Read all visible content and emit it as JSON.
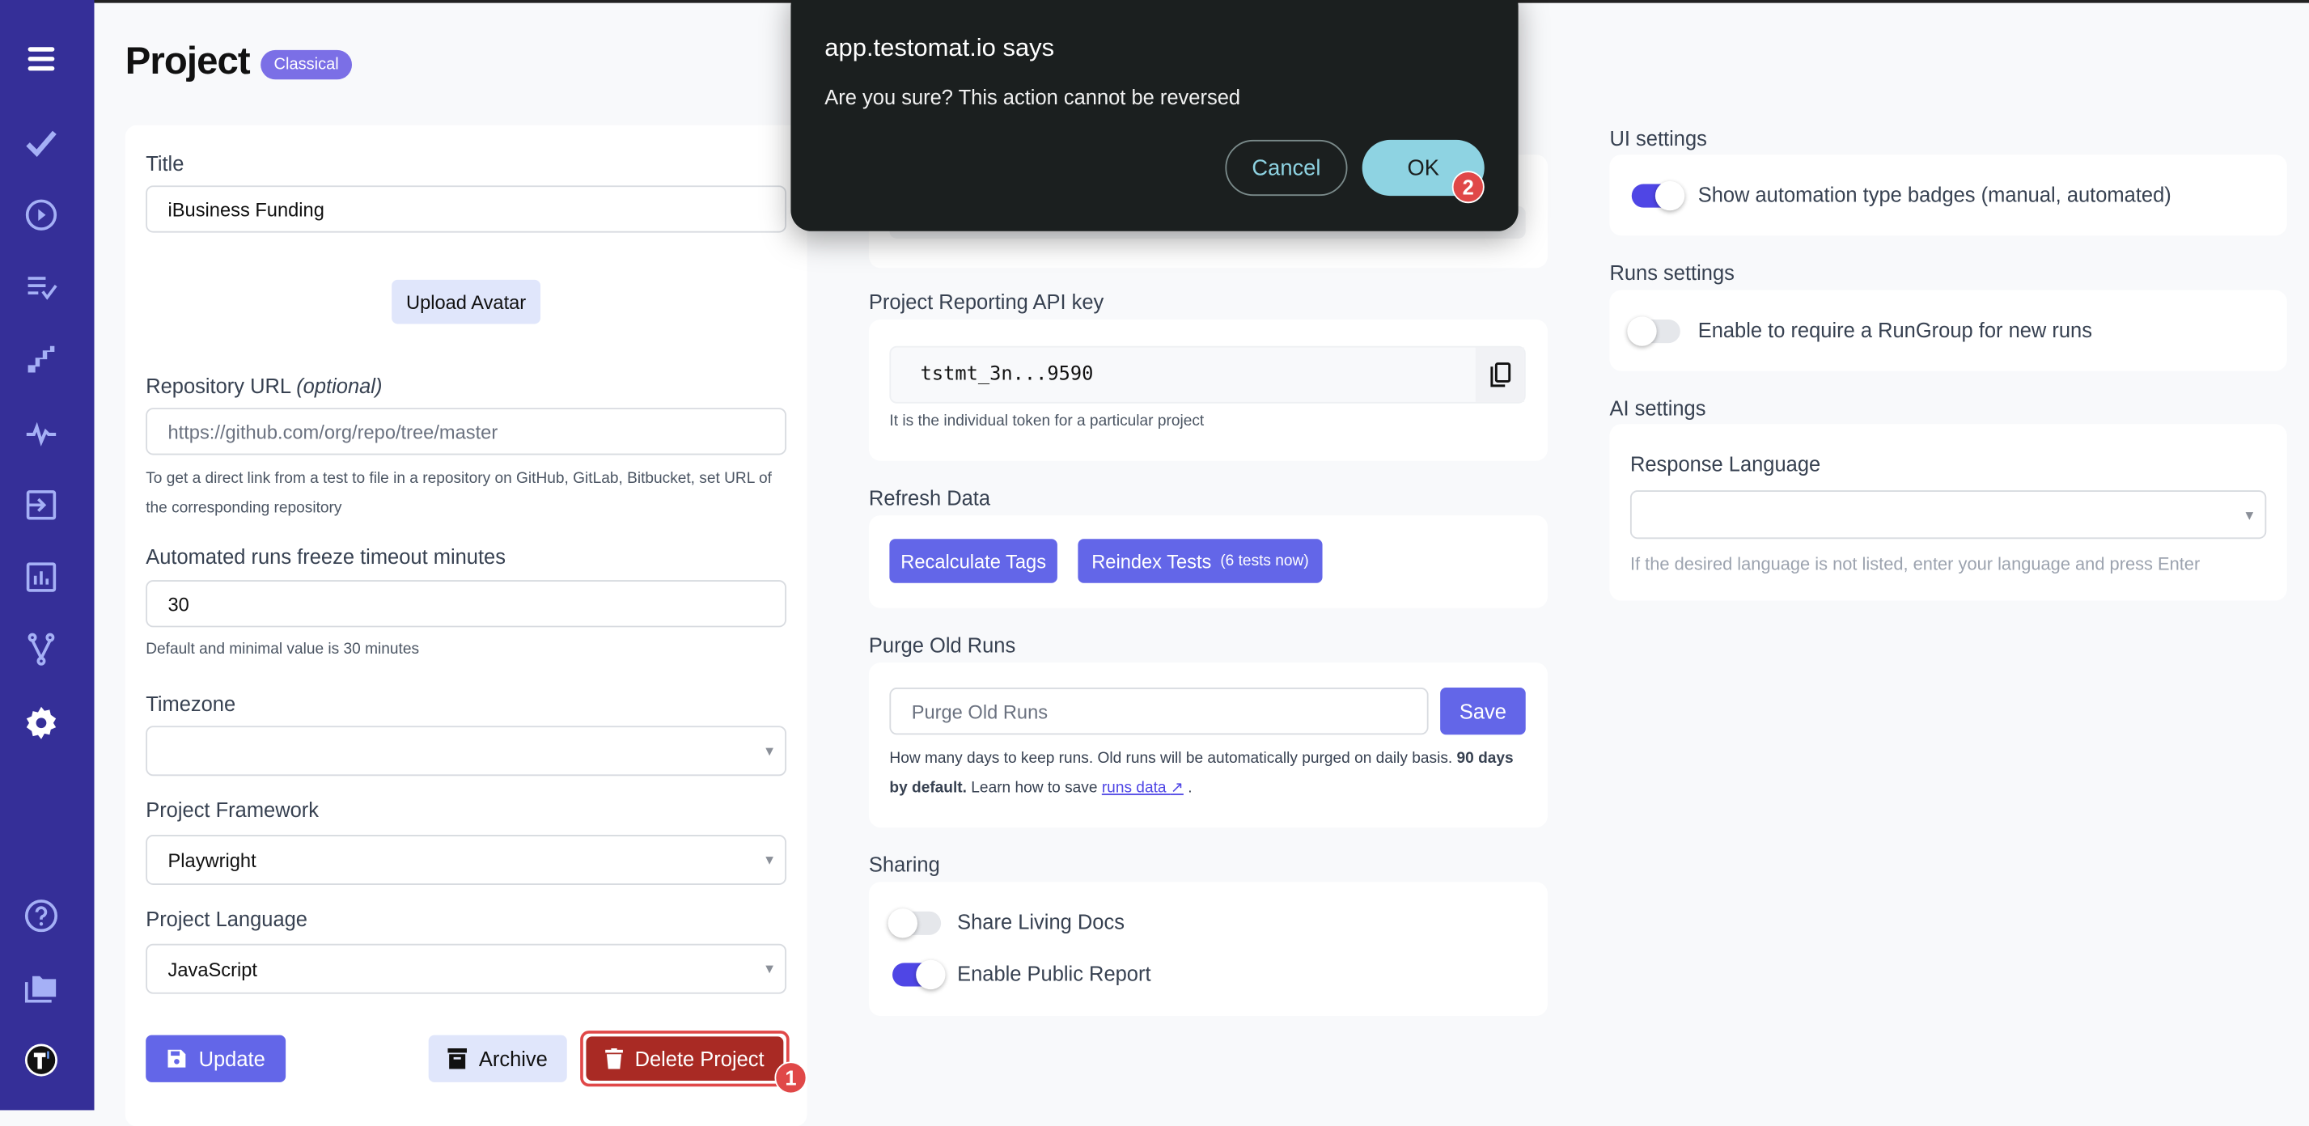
{
  "dialog": {
    "title": "app.testomat.io says",
    "message": "Are you sure? This action cannot be reversed",
    "cancel_label": "Cancel",
    "ok_label": "OK",
    "ok_marker": "2"
  },
  "sidebar": {
    "items": [
      "menu-icon",
      "check-icon",
      "play-circle-icon",
      "checklist-icon",
      "steps-icon",
      "pulse-icon",
      "import-icon",
      "analytics-icon",
      "branch-icon",
      "gear-icon",
      "help-icon",
      "folder-icon",
      "testomat-logo"
    ]
  },
  "header": {
    "title": "Project",
    "badge": "Classical"
  },
  "project_form": {
    "title_label": "Title",
    "title_value": "iBusiness Funding",
    "upload_avatar": "Upload Avatar",
    "repo_label": "Repository URL",
    "repo_optional": "(optional)",
    "repo_placeholder": "https://github.com/org/repo/tree/master",
    "repo_help": "To get a direct link from a test to file in a repository on GitHub, GitLab, Bitbucket, set URL of the corresponding repository",
    "freeze_label": "Automated runs freeze timeout minutes",
    "freeze_value": "30",
    "freeze_help": "Default and minimal value is 30 minutes",
    "timezone_label": "Timezone",
    "timezone_value": "",
    "framework_label": "Project Framework",
    "framework_value": "Playwright",
    "language_label": "Project Language",
    "language_value": "JavaScript",
    "update": "Update",
    "archive": "Archive",
    "delete": "Delete Project",
    "delete_marker": "1"
  },
  "api_key": {
    "label": "Project Reporting API key",
    "value": "tstmt_3n...9590",
    "help": "It is the individual token for a particular project"
  },
  "refresh": {
    "label": "Refresh Data",
    "recalculate": "Recalculate Tags",
    "reindex": "Reindex Tests",
    "reindex_count": "(6 tests now)"
  },
  "purge": {
    "label": "Purge Old Runs",
    "placeholder": "Purge Old Runs",
    "save": "Save",
    "help_pre": "How many days to keep runs. Old runs will be automatically purged on daily basis.",
    "help_bold": "90 days by default.",
    "help_mid": "Learn how to save",
    "link": "runs data",
    "help_end": "."
  },
  "sharing": {
    "label": "Sharing",
    "living_docs": {
      "label": "Share Living Docs",
      "on": false
    },
    "public_report": {
      "label": "Enable Public Report",
      "on": true
    }
  },
  "ui_settings": {
    "label": "UI settings",
    "badges": {
      "label": "Show automation type badges (manual, automated)",
      "on": true
    }
  },
  "runs_settings": {
    "label": "Runs settings",
    "rungroup": {
      "label": "Enable to require a RunGroup for new runs",
      "on": false
    }
  },
  "ai_settings": {
    "label": "AI settings",
    "response_language_label": "Response Language",
    "response_language_value": "",
    "help": "If the desired language is not listed, enter your language and press Enter"
  },
  "colors": {
    "sidebar": "#352f98",
    "primary": "#6366e8",
    "danger": "#a92a24",
    "toggle_on": "#4f46e5",
    "dialog_ok": "#8ed3e2"
  }
}
